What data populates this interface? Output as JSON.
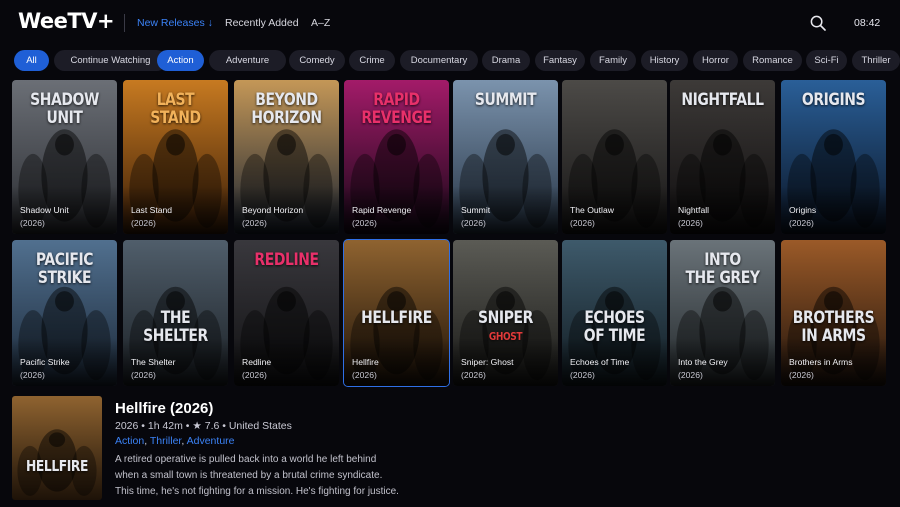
{
  "header": {
    "logo": "WeeTV+",
    "nav": [
      {
        "label": "New Releases ↓",
        "active": true
      },
      {
        "label": "Recently Added",
        "active": false
      },
      {
        "label": "A–Z",
        "active": false
      }
    ],
    "clock": "08:42",
    "icons": {
      "search": "search-icon"
    }
  },
  "genres": [
    "All",
    "Continue Watching",
    "Action",
    "Adventure",
    "Comedy",
    "Crime",
    "Documentary",
    "Drama",
    "Fantasy",
    "Family",
    "History",
    "Horror",
    "Romance",
    "Sci-Fi",
    "Thriller"
  ],
  "active_genres": [
    "All",
    "Action"
  ],
  "accent": "#2f6fe6",
  "movies": [
    {
      "title": "Shadow Unit",
      "year": "(2026)",
      "poster": [
        "SHADOW",
        "UNIT"
      ],
      "palette": [
        "#6b6f76",
        "#2a2c31"
      ]
    },
    {
      "title": "Last Stand",
      "year": "(2026)",
      "poster": [
        "LAST",
        "STAND"
      ],
      "palette": [
        "#c77a21",
        "#3a1d07"
      ]
    },
    {
      "title": "Beyond Horizon",
      "year": "(2026)",
      "poster": [
        "BEYOND",
        "HORIZON"
      ],
      "palette": [
        "#c49757",
        "#1a2331"
      ]
    },
    {
      "title": "Rapid Revenge",
      "year": "(2026)",
      "poster": [
        "RAPID",
        "REVENGE"
      ],
      "palette": [
        "#a31b69",
        "#140716"
      ]
    },
    {
      "title": "Summit",
      "year": "(2026)",
      "poster": [
        "SUMMIT"
      ],
      "palette": [
        "#7b93ad",
        "#263445"
      ]
    },
    {
      "title": "The Outlaw",
      "year": "(2026)",
      "poster": [],
      "palette": [
        "#4c4a47",
        "#151414"
      ]
    },
    {
      "title": "Nightfall",
      "year": "(2026)",
      "poster": [
        "NIGHTFALL"
      ],
      "palette": [
        "#3d3a38",
        "#0f0d0e"
      ]
    },
    {
      "title": "Origins",
      "year": "(2026)",
      "poster": [
        "ORIGINS"
      ],
      "palette": [
        "#2a5f98",
        "#0a1424"
      ]
    },
    {
      "title": "Pacific Strike",
      "year": "(2026)",
      "poster": [
        "PACIFIC",
        "STRIKE"
      ],
      "palette": [
        "#51708f",
        "#1b2838"
      ]
    },
    {
      "title": "The Shelter",
      "year": "(2026)",
      "poster": [
        "THE",
        "SHELTER"
      ],
      "palette": [
        "#505e6b",
        "#1a1f24"
      ]
    },
    {
      "title": "Redline",
      "year": "(2026)",
      "poster": [
        "REDLINE"
      ],
      "palette": [
        "#39383d",
        "#101012"
      ]
    },
    {
      "title": "Hellfire",
      "year": "(2026)",
      "poster": [
        "HELLFIRE"
      ],
      "palette": [
        "#8f6330",
        "#1d1208"
      ]
    },
    {
      "title": "Sniper: Ghost",
      "year": "(2026)",
      "poster": [
        "SNIPER",
        "GHOST"
      ],
      "palette": [
        "#5b5b55",
        "#181816"
      ]
    },
    {
      "title": "Echoes of Time",
      "year": "(2026)",
      "poster": [
        "ECHOES",
        "OF TIME"
      ],
      "palette": [
        "#3e5a6b",
        "#101a20"
      ]
    },
    {
      "title": "Into the Grey",
      "year": "(2026)",
      "poster": [
        "INTO",
        "THE GREY"
      ],
      "palette": [
        "#6a7379",
        "#22272a"
      ]
    },
    {
      "title": "Brothers in Arms",
      "year": "(2026)",
      "poster": [
        "BROTHERS",
        "IN ARMS"
      ],
      "palette": [
        "#9b5a28",
        "#1f130c"
      ]
    }
  ],
  "selected_index": 11,
  "detail": {
    "title": "Hellfire (2026)",
    "meta": "2026 • 1h 42m • ★ 7.6 • United States",
    "genres": [
      "Action",
      "Thriller",
      "Adventure"
    ],
    "description": [
      "A retired operative is pulled back into a world he left behind",
      "when a small town is threatened by a brutal crime syndicate.",
      "This time, he's not fighting for a mission. He's fighting for justice."
    ],
    "thumb_title": "HELLFIRE"
  }
}
